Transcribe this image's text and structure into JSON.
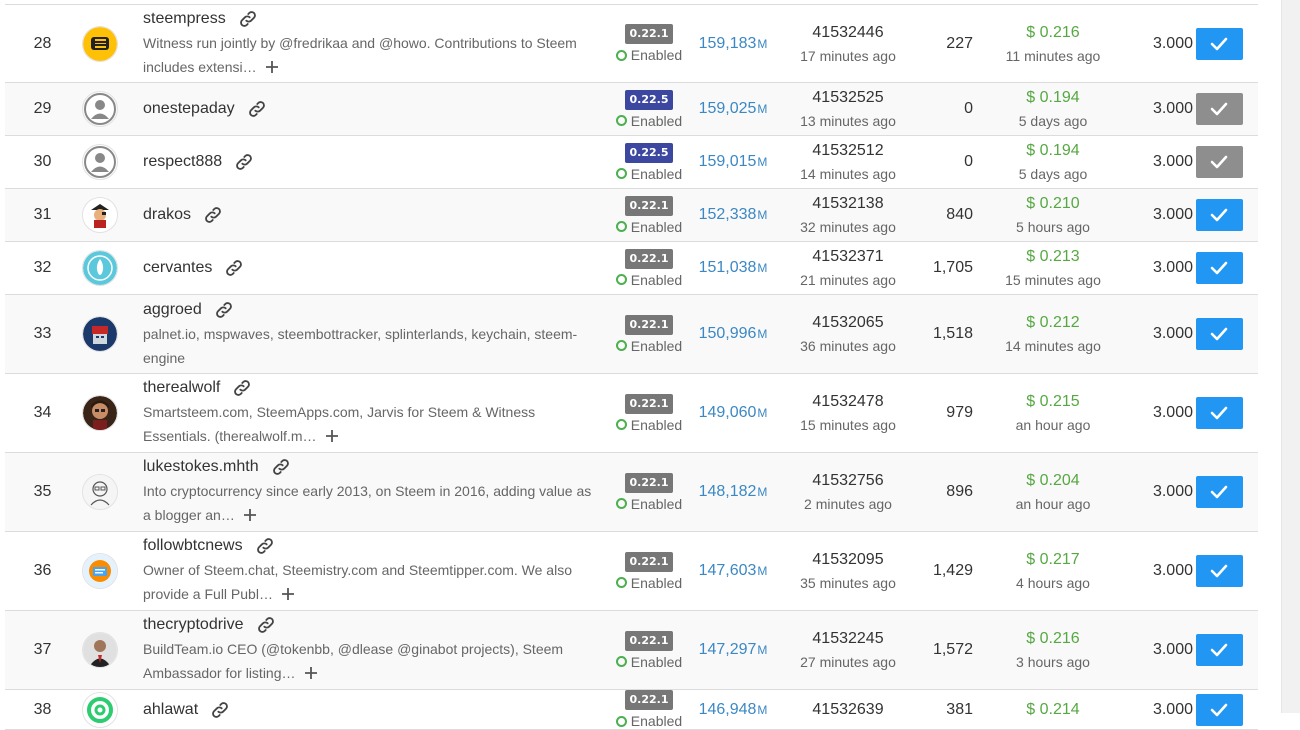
{
  "colors": {
    "version_default": "#777777",
    "version_new": "#3c48a0",
    "vote_active": "#2196f3",
    "vote_inactive": "#8e8e8e",
    "price": "#56a842",
    "votes": "#3b88c4"
  },
  "rows": [
    {
      "rank": "28",
      "name": "steempress",
      "avatar_icon": "steempress-logo-icon",
      "desc": "Witness run jointly by @fredrikaa and @howo. Contributions to Steem includes extensi…",
      "has_more": true,
      "version": "0.22.1",
      "version_new": false,
      "status": "Enabled",
      "votes": "159,183",
      "votes_unit": "M",
      "block": "41532446",
      "block_time": "17 minutes ago",
      "missed": "227",
      "price": "$ 0.216",
      "price_time": "11 minutes ago",
      "ratio": "3.000",
      "voted": true
    },
    {
      "rank": "29",
      "name": "onestepaday",
      "avatar_icon": "default-user-icon",
      "desc": "",
      "has_more": false,
      "version": "0.22.5",
      "version_new": true,
      "status": "Enabled",
      "votes": "159,025",
      "votes_unit": "M",
      "block": "41532525",
      "block_time": "13 minutes ago",
      "missed": "0",
      "price": "$ 0.194",
      "price_time": "5 days ago",
      "ratio": "3.000",
      "voted": false
    },
    {
      "rank": "30",
      "name": "respect888",
      "avatar_icon": "default-user-icon",
      "desc": "",
      "has_more": false,
      "version": "0.22.5",
      "version_new": true,
      "status": "Enabled",
      "votes": "159,015",
      "votes_unit": "M",
      "block": "41532512",
      "block_time": "14 minutes ago",
      "missed": "0",
      "price": "$ 0.194",
      "price_time": "5 days ago",
      "ratio": "3.000",
      "voted": false
    },
    {
      "rank": "31",
      "name": "drakos",
      "avatar_icon": "pirate-avatar-icon",
      "desc": "",
      "has_more": false,
      "version": "0.22.1",
      "version_new": false,
      "status": "Enabled",
      "votes": "152,338",
      "votes_unit": "M",
      "block": "41532138",
      "block_time": "32 minutes ago",
      "missed": "840",
      "price": "$ 0.210",
      "price_time": "5 hours ago",
      "ratio": "3.000",
      "voted": true
    },
    {
      "rank": "32",
      "name": "cervantes",
      "avatar_icon": "flame-avatar-icon",
      "desc": "",
      "has_more": false,
      "version": "0.22.1",
      "version_new": false,
      "status": "Enabled",
      "votes": "151,038",
      "votes_unit": "M",
      "block": "41532371",
      "block_time": "21 minutes ago",
      "missed": "1,705",
      "price": "$ 0.213",
      "price_time": "15 minutes ago",
      "ratio": "3.000",
      "voted": true
    },
    {
      "rank": "33",
      "name": "aggroed",
      "avatar_icon": "robot-avatar-icon",
      "desc": "palnet.io, mspwaves, steembottracker, splinterlands, keychain, steem-engine",
      "has_more": false,
      "version": "0.22.1",
      "version_new": false,
      "status": "Enabled",
      "votes": "150,996",
      "votes_unit": "M",
      "block": "41532065",
      "block_time": "36 minutes ago",
      "missed": "1,518",
      "price": "$ 0.212",
      "price_time": "14 minutes ago",
      "ratio": "3.000",
      "voted": true
    },
    {
      "rank": "34",
      "name": "therealwolf",
      "avatar_icon": "portrait-avatar-icon",
      "desc": "Smartsteem.com, SteemApps.com, Jarvis for Steem & Witness Essentials. (therealwolf.m…",
      "has_more": true,
      "version": "0.22.1",
      "version_new": false,
      "status": "Enabled",
      "votes": "149,060",
      "votes_unit": "M",
      "block": "41532478",
      "block_time": "15 minutes ago",
      "missed": "979",
      "price": "$ 0.215",
      "price_time": "an hour ago",
      "ratio": "3.000",
      "voted": true
    },
    {
      "rank": "35",
      "name": "lukestokes.mhth",
      "avatar_icon": "sketch-avatar-icon",
      "desc": "Into cryptocurrency since early 2013, on Steem in 2016, adding value as a blogger an…",
      "has_more": true,
      "version": "0.22.1",
      "version_new": false,
      "status": "Enabled",
      "votes": "148,182",
      "votes_unit": "M",
      "block": "41532756",
      "block_time": "2 minutes ago",
      "missed": "896",
      "price": "$ 0.204",
      "price_time": "an hour ago",
      "ratio": "3.000",
      "voted": true
    },
    {
      "rank": "36",
      "name": "followbtcnews",
      "avatar_icon": "news-avatar-icon",
      "desc": "Owner of Steem.chat, Steemistry.com and Steemtipper.com. We also provide a Full Publ…",
      "has_more": true,
      "version": "0.22.1",
      "version_new": false,
      "status": "Enabled",
      "votes": "147,603",
      "votes_unit": "M",
      "block": "41532095",
      "block_time": "35 minutes ago",
      "missed": "1,429",
      "price": "$ 0.217",
      "price_time": "4 hours ago",
      "ratio": "3.000",
      "voted": true
    },
    {
      "rank": "37",
      "name": "thecryptodrive",
      "avatar_icon": "suit-avatar-icon",
      "desc": "BuildTeam.io CEO (@tokenbb, @dlease @ginabot projects), Steem Ambassador for listing…",
      "has_more": true,
      "version": "0.22.1",
      "version_new": false,
      "status": "Enabled",
      "votes": "147,297",
      "votes_unit": "M",
      "block": "41532245",
      "block_time": "27 minutes ago",
      "missed": "1,572",
      "price": "$ 0.216",
      "price_time": "3 hours ago",
      "ratio": "3.000",
      "voted": true
    },
    {
      "rank": "38",
      "name": "ahlawat",
      "avatar_icon": "at-sign-avatar-icon",
      "desc": "",
      "has_more": false,
      "version": "0.22.1",
      "version_new": false,
      "status": "Enabled",
      "votes": "146,948",
      "votes_unit": "M",
      "block": "41532639",
      "block_time": "",
      "missed": "381",
      "price": "$ 0.214",
      "price_time": "",
      "ratio": "3.000",
      "voted": true
    }
  ]
}
